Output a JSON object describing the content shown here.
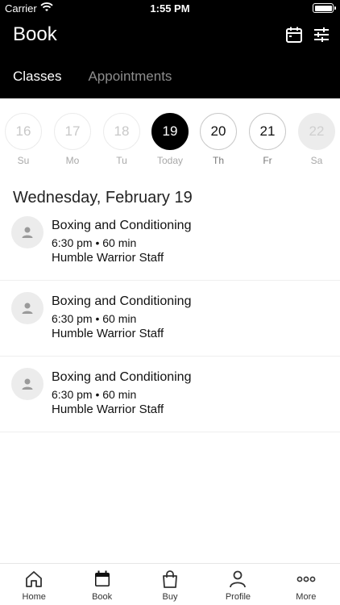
{
  "status_bar": {
    "carrier": "Carrier",
    "time": "1:55 PM"
  },
  "header": {
    "title": "Book"
  },
  "tabs": [
    {
      "label": "Classes",
      "active": true
    },
    {
      "label": "Appointments",
      "active": false
    }
  ],
  "week": [
    {
      "num": "16",
      "label": "Su",
      "state": "past"
    },
    {
      "num": "17",
      "label": "Mo",
      "state": "past"
    },
    {
      "num": "18",
      "label": "Tu",
      "state": "past"
    },
    {
      "num": "19",
      "label": "Today",
      "state": "today"
    },
    {
      "num": "20",
      "label": "Th",
      "state": "future"
    },
    {
      "num": "21",
      "label": "Fr",
      "state": "future"
    },
    {
      "num": "22",
      "label": "Sa",
      "state": "disabled"
    }
  ],
  "date_heading": "Wednesday, February 19",
  "classes": [
    {
      "name": "Boxing and Conditioning",
      "time": "6:30 pm • 60 min",
      "staff": "Humble Warrior Staff"
    },
    {
      "name": "Boxing and Conditioning",
      "time": "6:30 pm • 60 min",
      "staff": "Humble Warrior Staff"
    },
    {
      "name": "Boxing and Conditioning",
      "time": "6:30 pm • 60 min",
      "staff": "Humble Warrior Staff"
    }
  ],
  "nav": [
    {
      "label": "Home"
    },
    {
      "label": "Book"
    },
    {
      "label": "Buy"
    },
    {
      "label": "Profile"
    },
    {
      "label": "More"
    }
  ],
  "colors": {
    "header_bg": "#000000",
    "today_bg": "#000000",
    "muted": "#8d8d8d"
  }
}
